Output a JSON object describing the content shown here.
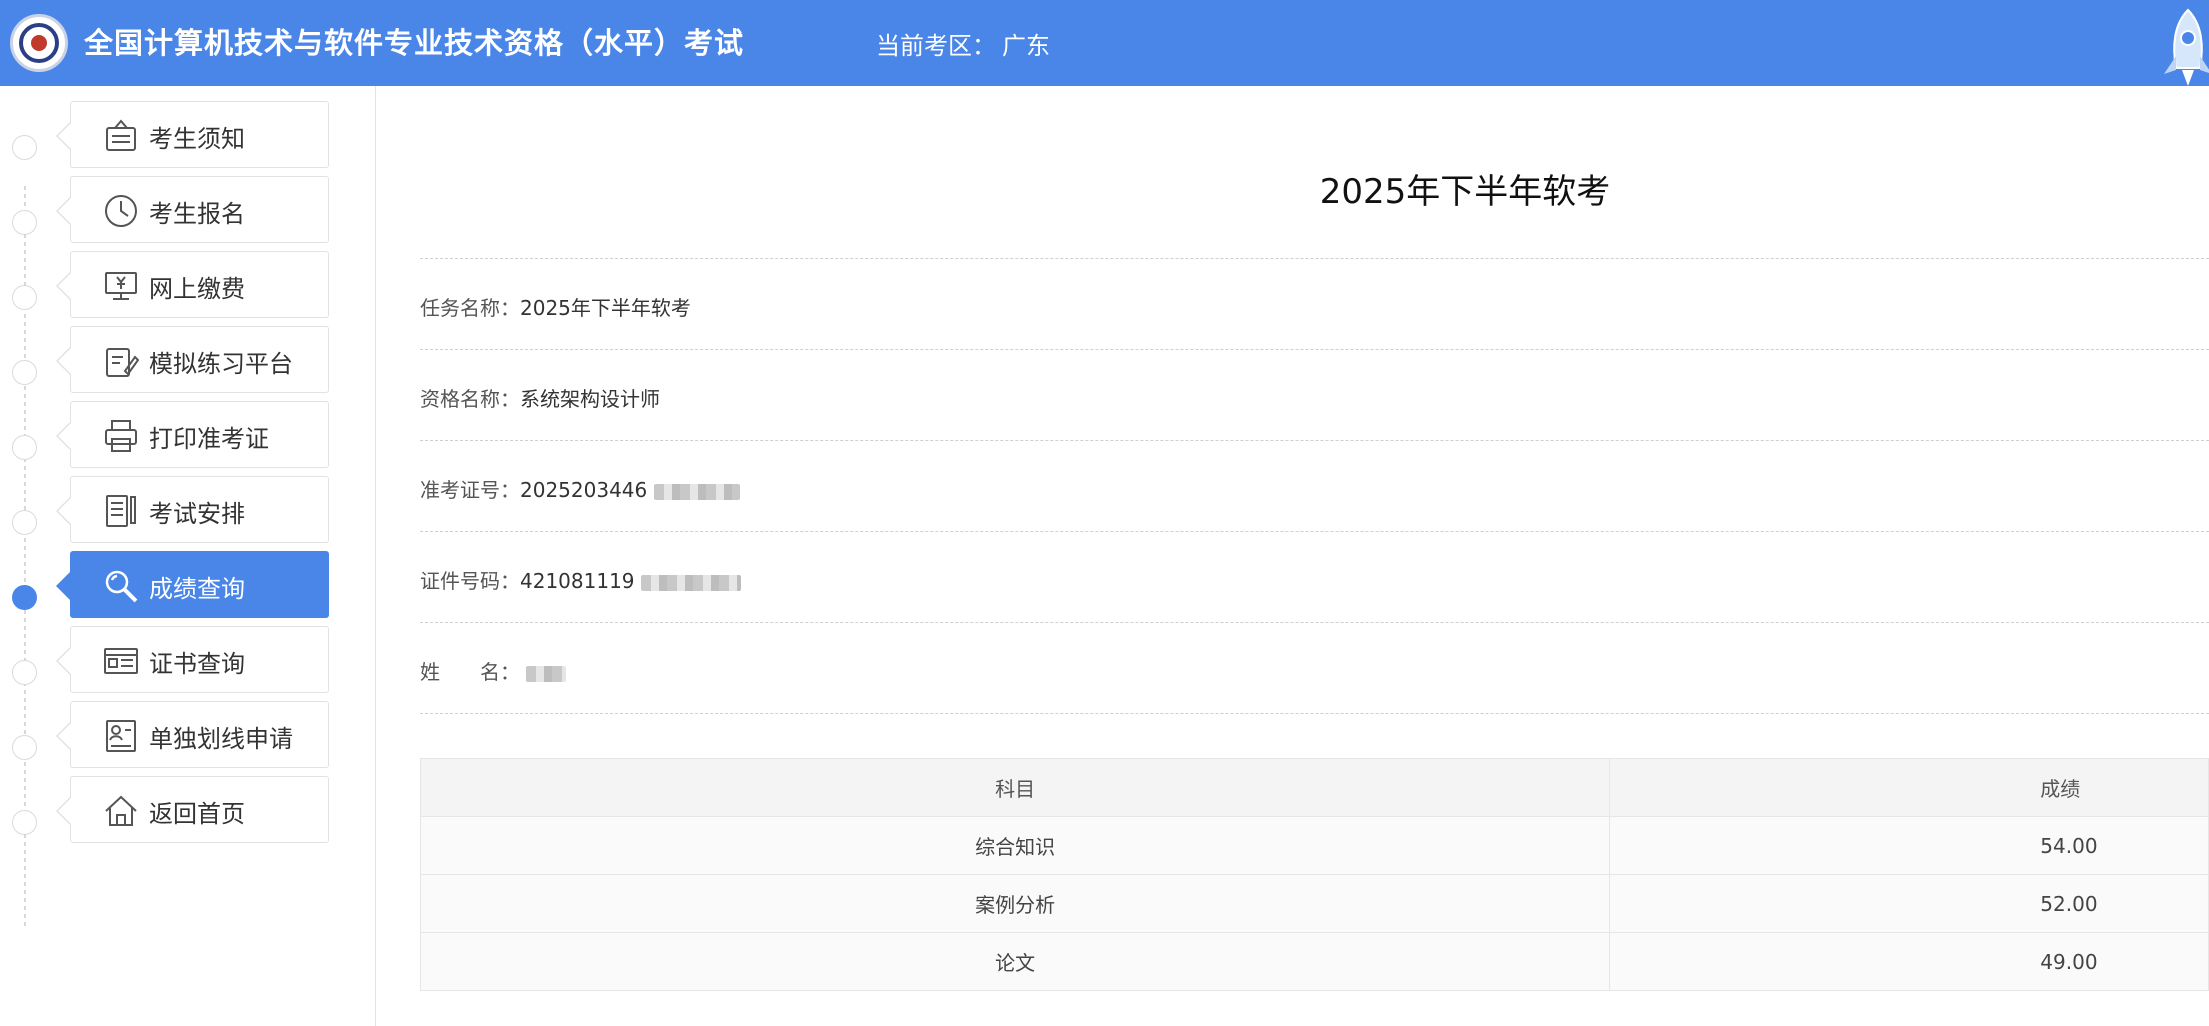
{
  "header": {
    "title": "全国计算机技术与软件专业技术资格（水平）考试",
    "region_label": "当前考区：",
    "region_value": "广东"
  },
  "sidebar": {
    "items": [
      {
        "label": "考生须知",
        "icon": "notice-board-icon"
      },
      {
        "label": "考生报名",
        "icon": "clock-icon"
      },
      {
        "label": "网上缴费",
        "icon": "monitor-yen-icon"
      },
      {
        "label": "模拟练习平台",
        "icon": "notepad-pen-icon"
      },
      {
        "label": "打印准考证",
        "icon": "printer-icon"
      },
      {
        "label": "考试安排",
        "icon": "document-pencil-icon"
      },
      {
        "label": "成绩查询",
        "icon": "magnifier-icon",
        "active": true
      },
      {
        "label": "证书查询",
        "icon": "certificate-icon"
      },
      {
        "label": "单独划线申请",
        "icon": "profile-card-icon"
      },
      {
        "label": "返回首页",
        "icon": "home-icon"
      }
    ]
  },
  "main": {
    "title": "2025年下半年软考",
    "fields": [
      {
        "label": "任务名称：",
        "value": "2025年下半年软考"
      },
      {
        "label": "资格名称：",
        "value": "系统架构设计师"
      },
      {
        "label": "准考证号：",
        "value": "2025203446"
      },
      {
        "label": "证件号码：",
        "value": "421081119"
      },
      {
        "label": "姓　　名：",
        "value": ""
      }
    ],
    "table": {
      "headers": [
        "科目",
        "成绩"
      ],
      "rows": [
        [
          "综合知识",
          "54.00"
        ],
        [
          "案例分析",
          "52.00"
        ],
        [
          "论文",
          "49.00"
        ]
      ]
    }
  },
  "colors": {
    "accent": "#4a86e8"
  }
}
